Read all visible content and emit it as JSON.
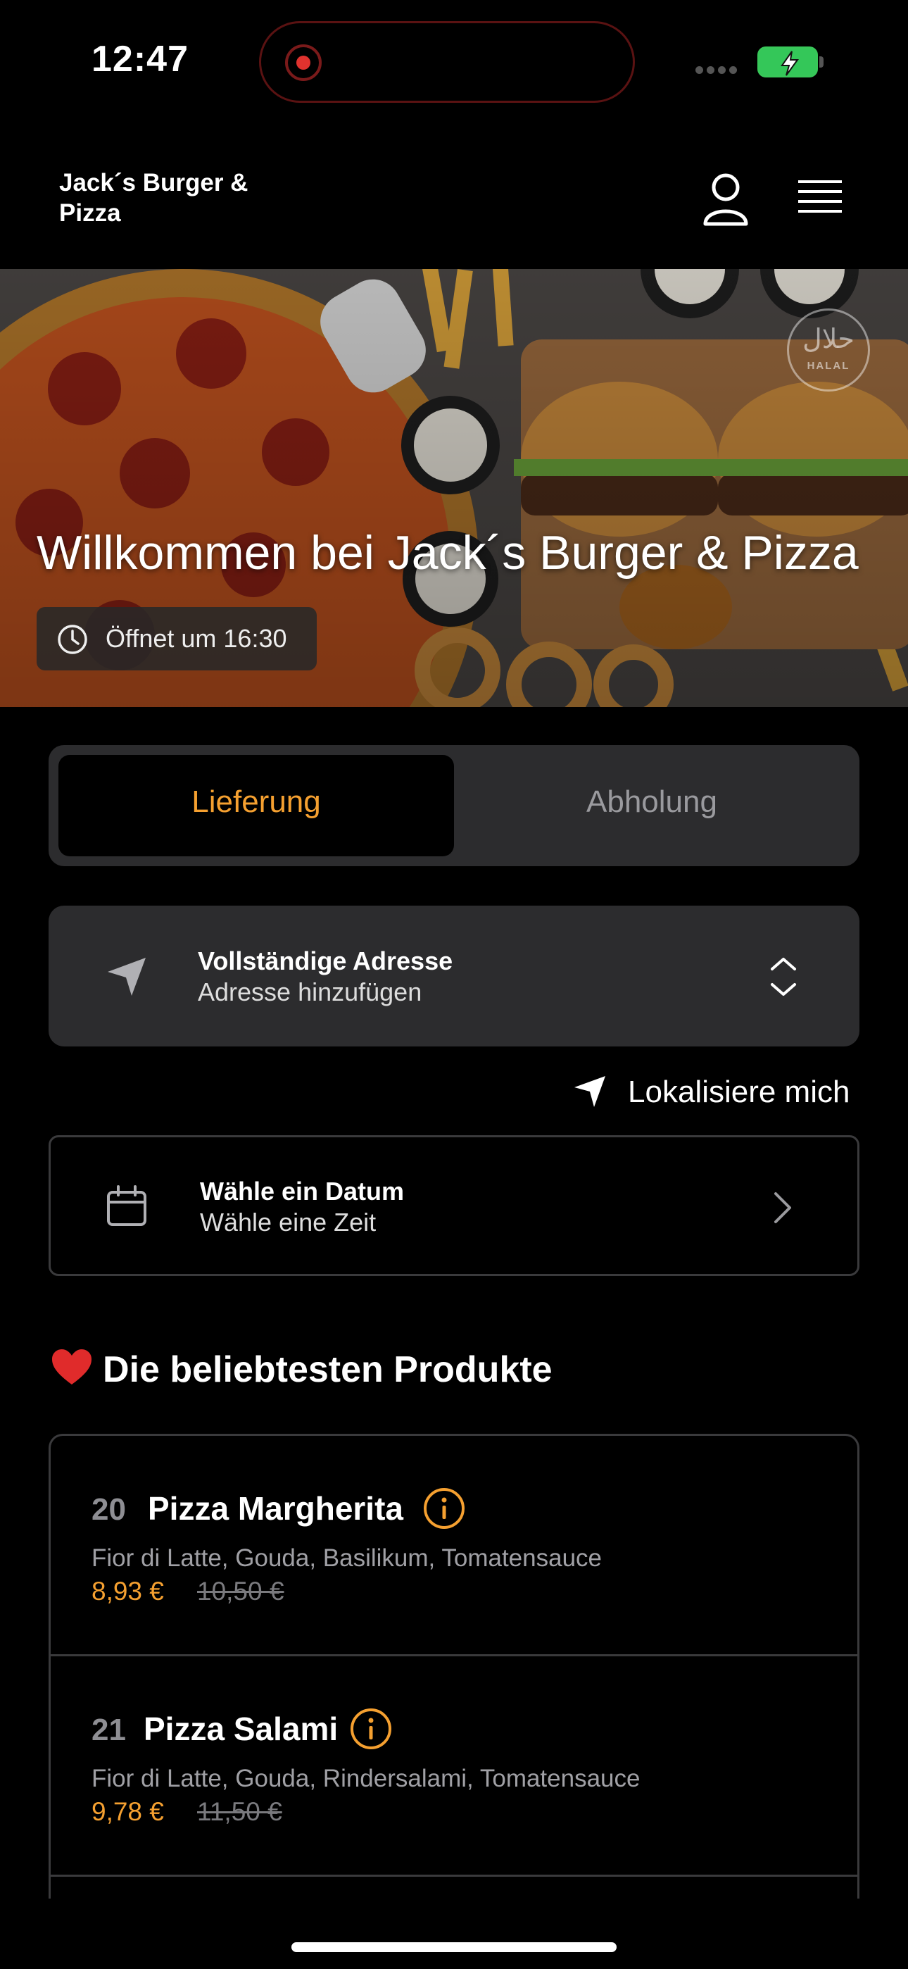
{
  "status_bar": {
    "time": "12:47"
  },
  "header": {
    "brand": "Jack´s Burger & Pizza",
    "user_icon": "user-icon",
    "menu_icon": "hamburger-menu-icon"
  },
  "hero": {
    "title": "Willkommen bei Jack´s Burger & Pizza",
    "open_text": "Öffnet um 16:30",
    "halal_ar": "حلال",
    "halal_en": "HALAL"
  },
  "order_mode": {
    "options": [
      "Lieferung",
      "Abholung"
    ],
    "selected": "Lieferung",
    "accent": "#f5a030"
  },
  "address": {
    "title": "Vollständige Adresse",
    "subtitle": "Adresse hinzufügen"
  },
  "locate": {
    "label": "Lokalisiere mich"
  },
  "date_picker": {
    "title": "Wähle ein Datum",
    "subtitle": "Wähle eine Zeit"
  },
  "popular": {
    "title": "Die beliebtesten Produkte",
    "products": [
      {
        "number": "20",
        "name": "Pizza Margherita",
        "description": "Fior di Latte, Gouda, Basilikum, Tomatensauce",
        "price": "8,93 €",
        "old_price": "10,50 €"
      },
      {
        "number": "21",
        "name": "Pizza Salami",
        "description": "Fior di Latte, Gouda, Rindersalami, Tomatensauce",
        "price": "9,78 €",
        "old_price": "11,50 €"
      }
    ]
  }
}
